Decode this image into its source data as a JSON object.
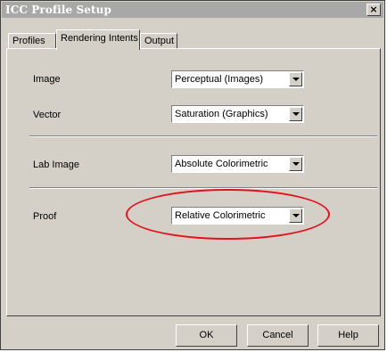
{
  "window": {
    "title": "ICC Profile Setup",
    "close_label": "×"
  },
  "tabs": [
    {
      "label": "Profiles"
    },
    {
      "label": "Rendering Intents",
      "active": true
    },
    {
      "label": "Output"
    }
  ],
  "rows": {
    "image": {
      "label": "Image",
      "value": "Perceptual (Images)"
    },
    "vector": {
      "label": "Vector",
      "value": "Saturation (Graphics)"
    },
    "lab_image": {
      "label": "Lab Image",
      "value": "Absolute Colorimetric"
    },
    "proof": {
      "label": "Proof",
      "value": "Relative Colorimetric"
    }
  },
  "highlight": {
    "color": "#e0141e",
    "target": "proof"
  },
  "buttons": {
    "ok": "OK",
    "cancel": "Cancel",
    "help": "Help"
  },
  "colors": {
    "dialog_face": "#d4d0c8",
    "titlebar_inactive": "#a8a8a8"
  }
}
